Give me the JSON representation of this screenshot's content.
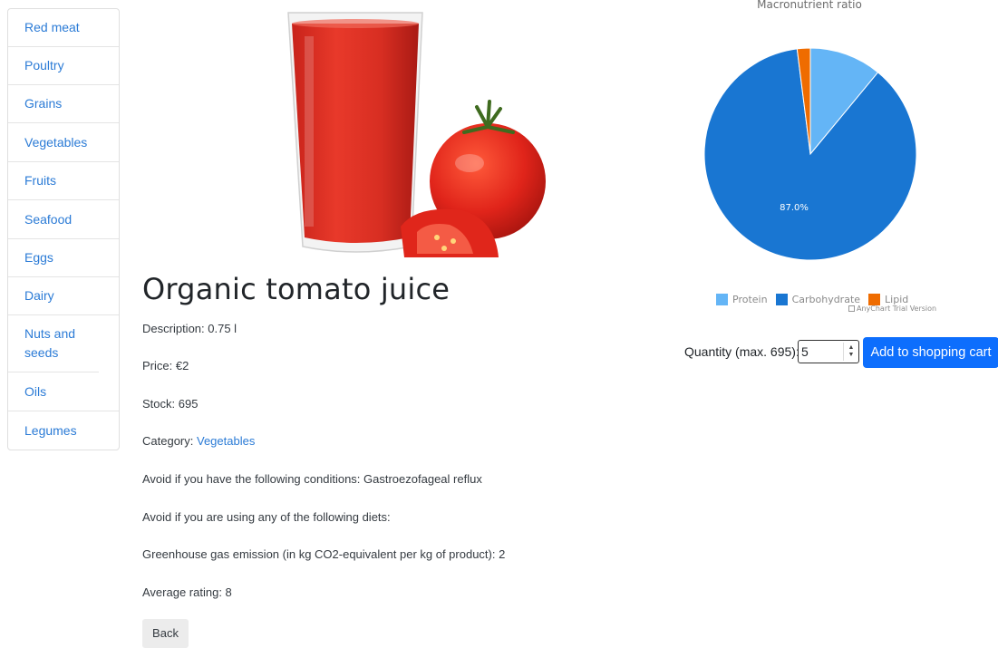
{
  "sidebar": {
    "items": [
      {
        "label": "Red meat"
      },
      {
        "label": "Poultry"
      },
      {
        "label": "Grains"
      },
      {
        "label": "Vegetables"
      },
      {
        "label": "Fruits"
      },
      {
        "label": "Seafood"
      },
      {
        "label": "Eggs"
      },
      {
        "label": "Dairy"
      },
      {
        "label": "Nuts and seeds"
      },
      {
        "label": "Oils"
      },
      {
        "label": "Legumes"
      }
    ]
  },
  "product": {
    "title": "Organic tomato juice",
    "description": "Description: 0.75 l",
    "price": "Price: €2",
    "stock": "Stock: 695",
    "category_prefix": "Category: ",
    "category_link": "Vegetables",
    "conditions": "Avoid if you have the following conditions: Gastroezofageal reflux",
    "diets": "Avoid if you are using any of the following diets:",
    "emission": "Greenhouse gas emission (in kg CO2-equivalent per kg of product): 2",
    "rating": "Average rating: 8",
    "back_label": "Back"
  },
  "purchase": {
    "quantity_label": "Quantity (max. 695):",
    "quantity_value": "5",
    "add_label": "Add to shopping cart"
  },
  "chart_data": {
    "type": "pie",
    "title": "Macronutrient ratio",
    "categories": [
      "Protein",
      "Carbohydrate",
      "Lipid"
    ],
    "values": [
      11,
      87,
      2
    ],
    "colors": [
      "#64b5f6",
      "#1976d2",
      "#ef6c00"
    ],
    "data_labels": [
      "",
      "87.0%",
      ""
    ],
    "legend_position": "bottom",
    "watermark": "AnyChart Trial Version"
  }
}
